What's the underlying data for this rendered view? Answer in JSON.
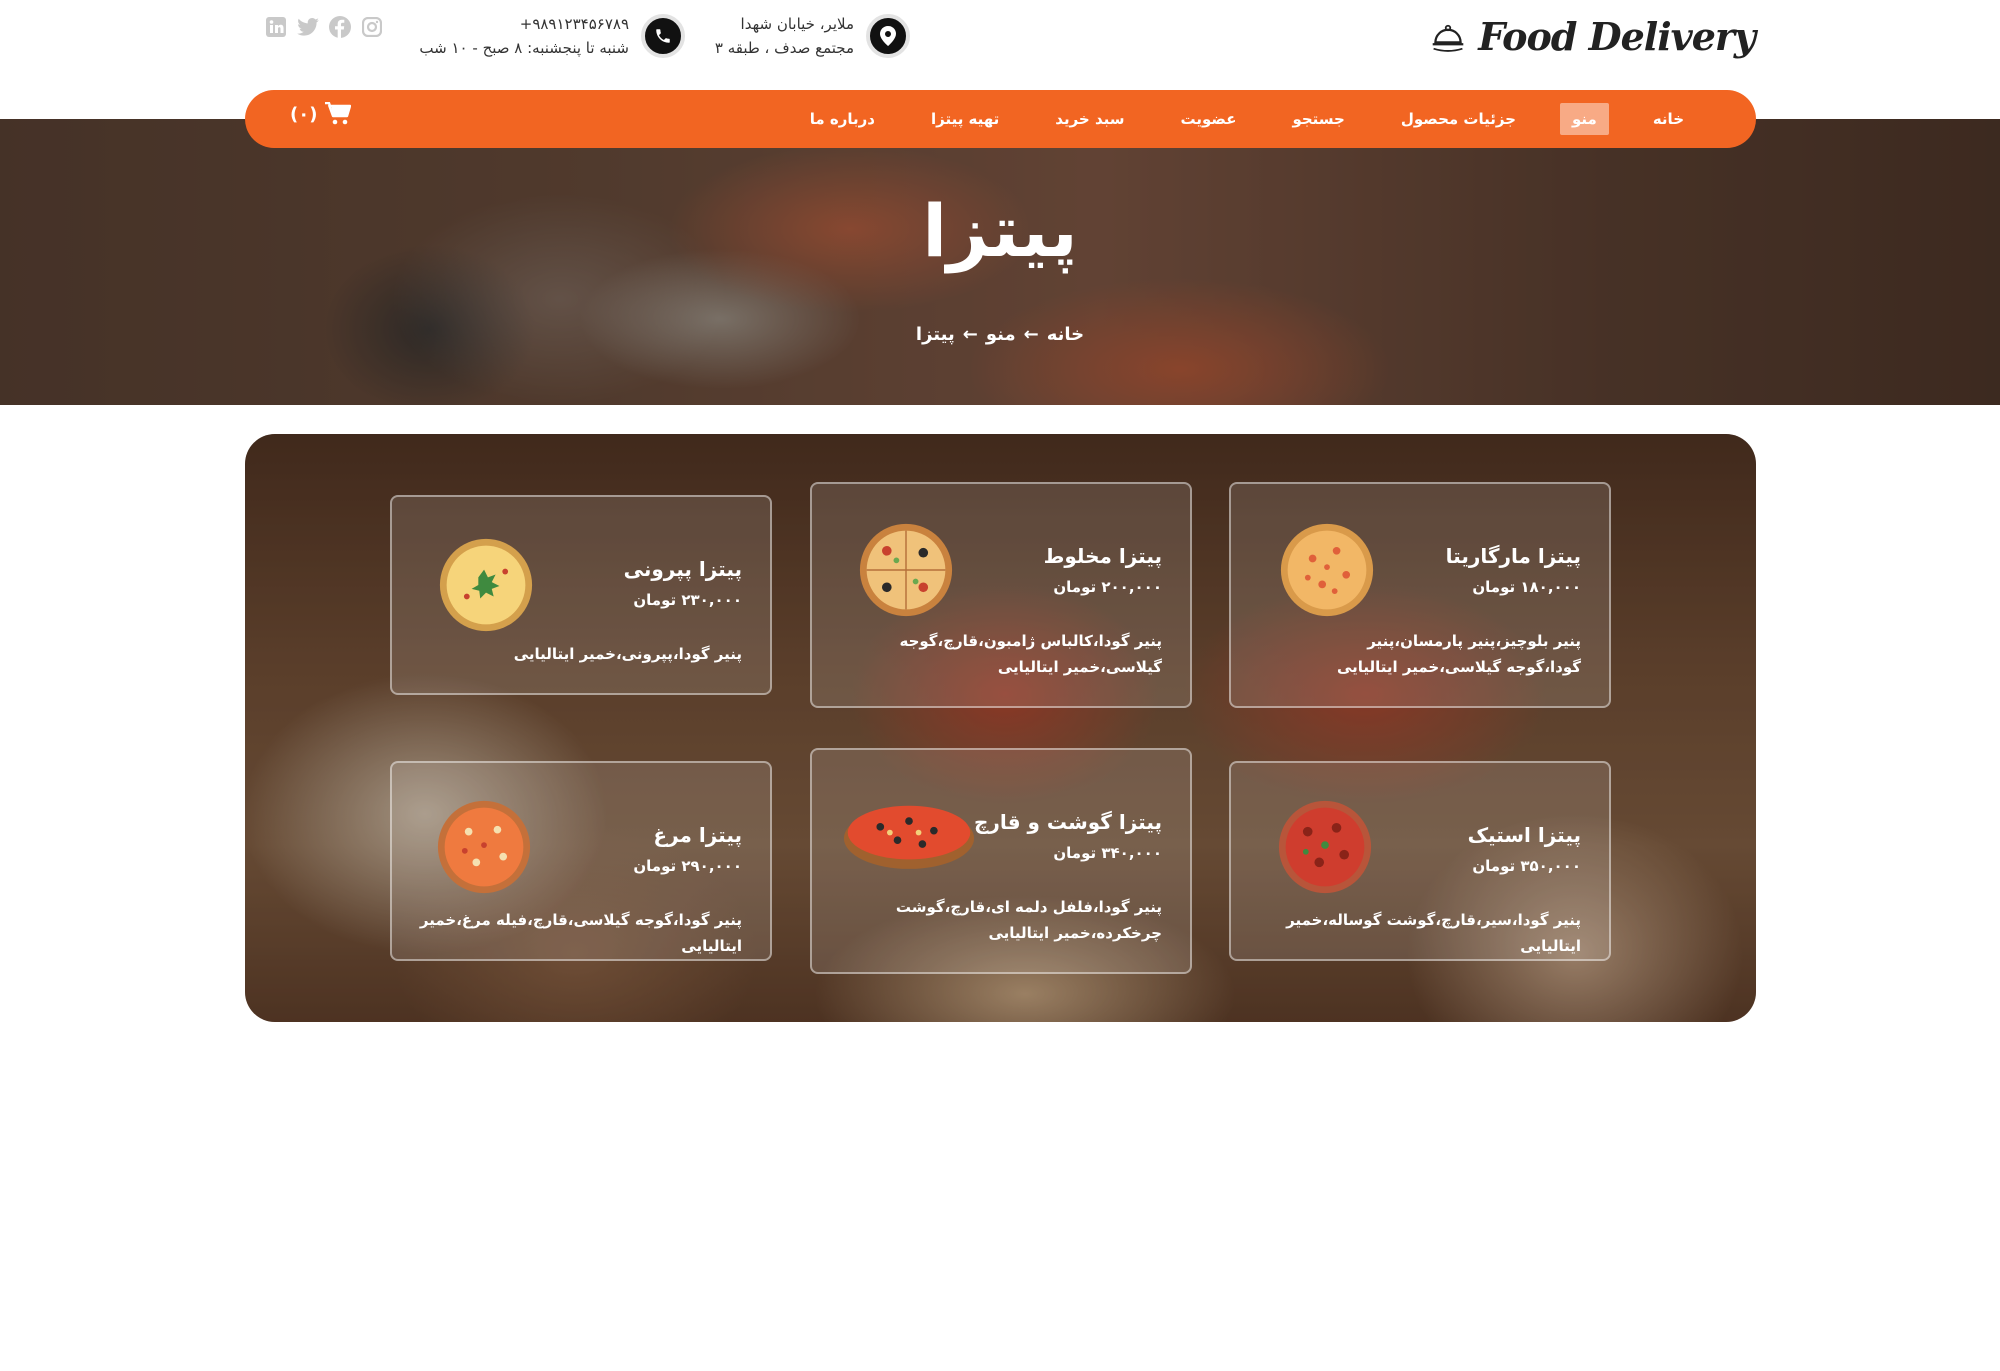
{
  "brand": {
    "name": "Food Delivery"
  },
  "contact": {
    "address_line1": "ملایر، خیابان شهدا",
    "address_line2": "مجتمع صدف ، طبقه ۳",
    "phone": "+۹۸۹۱۲۳۴۵۶۷۸۹",
    "hours": "شنبه تا پنجشنبه: ۸ صبح - ۱۰ شب"
  },
  "social_icons": [
    "instagram-icon",
    "facebook-icon",
    "twitter-icon",
    "linkedin-icon"
  ],
  "nav": {
    "items": [
      "خانه",
      "منو",
      "جزئیات محصول",
      "جستجو",
      "عضویت",
      "سبد خرید",
      "تهیه پیتزا",
      "درباره ما"
    ],
    "active": "منو",
    "cart_count": "(۰)"
  },
  "hero": {
    "title": "پیتزا",
    "breadcrumb": [
      "خانه",
      "منو",
      "پیتزا"
    ],
    "separator": "←"
  },
  "menu": {
    "items": [
      {
        "title": "پیتزا مارگاریتا",
        "price": "۱۸۰,۰۰۰ تومان",
        "desc": "پنیر بلوچیز،پنیر پارمسان،پنیر گودا،گوجه گیلاسی،خمیر ایتالیایی"
      },
      {
        "title": "پیتزا مخلوط",
        "price": "۲۰۰,۰۰۰ تومان",
        "desc": "پنیر گودا،کالباس ژامبون،قارچ،گوجه گیلاسی،خمیر ایتالیایی"
      },
      {
        "title": "پیتزا پپرونی",
        "price": "۲۳۰,۰۰۰ تومان",
        "desc": "پنیر گودا،پپرونی،خمیر ایتالیایی"
      },
      {
        "title": "پیتزا استیک",
        "price": "۳۵۰,۰۰۰ تومان",
        "desc": "پنیر گودا،سیر،قارچ،گوشت گوساله،خمیر ایتالیایی"
      },
      {
        "title": "پیتزا گوشت و قارچ",
        "price": "۳۴۰,۰۰۰ تومان",
        "desc": "پنیر گودا،فلفل دلمه ای،قارچ،گوشت چرخکرده،خمیر ایتالیایی"
      },
      {
        "title": "پیتزا مرغ",
        "price": "۲۹۰,۰۰۰ تومان",
        "desc": "پنیر گودا،گوجه گیلاسی،قارچ،فیله مرغ،خمیر ایتالیایی"
      }
    ]
  },
  "colors": {
    "accent": "#f26522",
    "white": "#ffffff",
    "dark": "#111111"
  }
}
